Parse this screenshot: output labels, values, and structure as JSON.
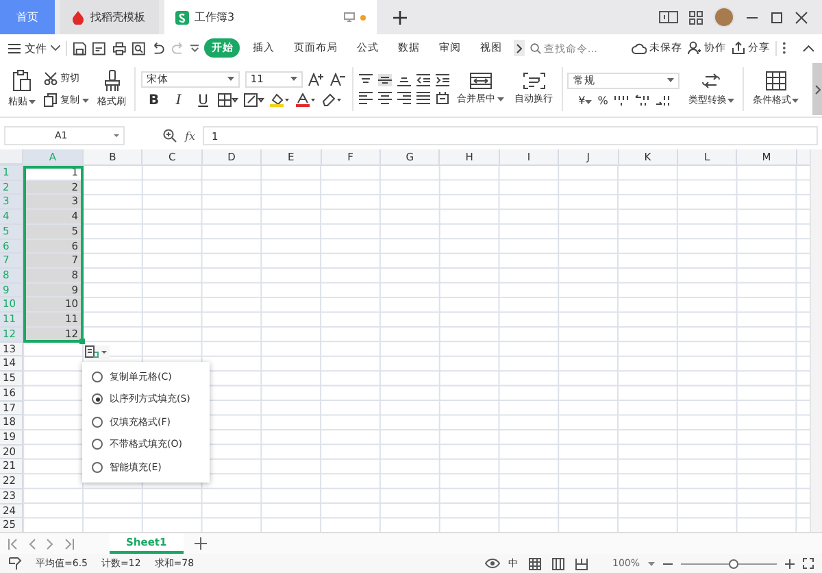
{
  "title_bar": {
    "tabs": [
      {
        "kind": "home",
        "label": "首页",
        "selected": false
      },
      {
        "kind": "template",
        "label": "找稻壳模板",
        "selected": false
      },
      {
        "kind": "sheet",
        "label": "工作簿3",
        "selected": true,
        "unsaved": true
      }
    ]
  },
  "menu": {
    "file": "文件",
    "tabs": [
      {
        "label": "开始",
        "selected": true
      },
      {
        "label": "插入",
        "selected": false
      },
      {
        "label": "页面布局",
        "selected": false
      },
      {
        "label": "公式",
        "selected": false
      },
      {
        "label": "数据",
        "selected": false
      },
      {
        "label": "审阅",
        "selected": false
      },
      {
        "label": "视图",
        "selected": false
      }
    ],
    "search": {
      "placeholder": "查找命令..."
    },
    "actions": [
      {
        "kind": "cloud",
        "label": "未保存"
      },
      {
        "kind": "user",
        "label": "协作"
      },
      {
        "kind": "share",
        "label": "分享"
      }
    ]
  },
  "ribbon": {
    "paste": "粘贴",
    "cut": "剪切",
    "copy": "复制",
    "format_painter": "格式刷",
    "font_name": "宋体",
    "font_size": "11",
    "style_buttons": [
      "B",
      "I",
      "U"
    ],
    "merge": "合并居中",
    "wrap": "自动换行",
    "number_format": "常规",
    "currency": "¥",
    "percent": "%",
    "convert": "类型转换",
    "conditional": "条件格式"
  },
  "formula_bar": {
    "name_box": "A1",
    "fx": "fx",
    "value": "1"
  },
  "sheet": {
    "columns": [
      "A",
      "B",
      "C",
      "D",
      "E",
      "F",
      "G",
      "H",
      "I",
      "J",
      "K",
      "L",
      "M"
    ],
    "rows": [
      {
        "label": "1",
        "value": "1",
        "selected": true
      },
      {
        "label": "2",
        "value": "2",
        "selected": true
      },
      {
        "label": "3",
        "value": "3",
        "selected": true
      },
      {
        "label": "4",
        "value": "4",
        "selected": true
      },
      {
        "label": "5",
        "value": "5",
        "selected": true
      },
      {
        "label": "6",
        "value": "6",
        "selected": true
      },
      {
        "label": "7",
        "value": "7",
        "selected": true
      },
      {
        "label": "8",
        "value": "8",
        "selected": true
      },
      {
        "label": "9",
        "value": "9",
        "selected": true
      },
      {
        "label": "10",
        "value": "10",
        "selected": true
      },
      {
        "label": "11",
        "value": "11",
        "selected": true
      },
      {
        "label": "12",
        "value": "12",
        "selected": true
      },
      {
        "label": "13",
        "selected": false
      },
      {
        "label": "14",
        "selected": false
      },
      {
        "label": "15",
        "selected": false
      },
      {
        "label": "16",
        "selected": false
      },
      {
        "label": "17",
        "selected": false
      },
      {
        "label": "18",
        "selected": false
      },
      {
        "label": "19",
        "selected": false
      },
      {
        "label": "20",
        "selected": false
      },
      {
        "label": "21",
        "selected": false
      },
      {
        "label": "22",
        "selected": false
      },
      {
        "label": "23",
        "selected": false
      },
      {
        "label": "24",
        "selected": false
      },
      {
        "label": "25",
        "selected": false
      }
    ]
  },
  "fill_menu": {
    "options": [
      {
        "label": "复制单元格(C)",
        "selected": false
      },
      {
        "label": "以序列方式填充(S)",
        "selected": true
      },
      {
        "label": "仅填充格式(F)",
        "selected": false
      },
      {
        "label": "不带格式填充(O)",
        "selected": false
      },
      {
        "label": "智能填充(E)",
        "selected": false
      }
    ]
  },
  "sheet_tabs": [
    {
      "label": "Sheet1",
      "selected": true
    }
  ],
  "status_bar": {
    "stats": [
      "平均值=6.5",
      "计数=12",
      "求和=78"
    ],
    "input_mode": "中",
    "zoom": "100%",
    "zoom_level": {
      "level": 0.55
    }
  }
}
